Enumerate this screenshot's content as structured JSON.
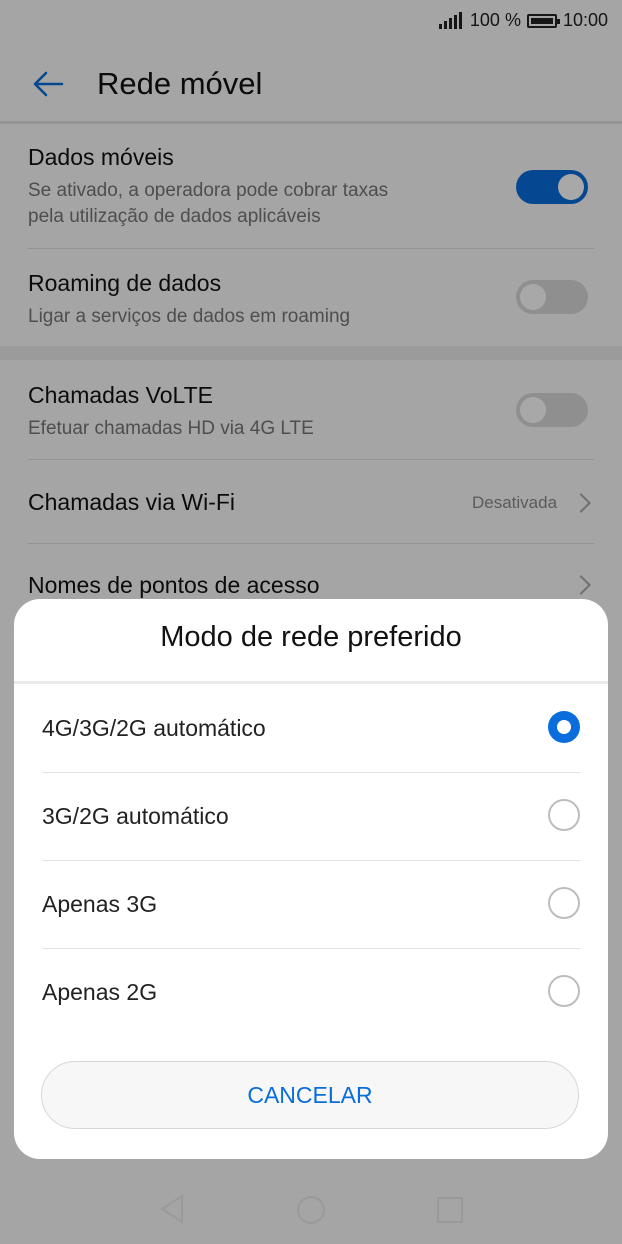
{
  "status_bar": {
    "battery_text": "100 %",
    "time": "10:00"
  },
  "header": {
    "title": "Rede móvel",
    "back_icon": "arrow-left-icon"
  },
  "settings": {
    "mobile_data": {
      "title": "Dados móveis",
      "subtitle_line1": "Se ativado, a operadora pode cobrar taxas",
      "subtitle_line2": "pela utilização de dados aplicáveis",
      "enabled": true
    },
    "data_roaming": {
      "title": "Roaming de dados",
      "subtitle": "Ligar a serviços de dados em roaming",
      "enabled": false
    },
    "volte": {
      "title": "Chamadas VoLTE",
      "subtitle": "Efetuar chamadas HD via 4G LTE",
      "enabled": false
    },
    "wifi_calling": {
      "title": "Chamadas via Wi-Fi",
      "value": "Desativada"
    },
    "apn": {
      "title": "Nomes de pontos de acesso"
    }
  },
  "dialog": {
    "title": "Modo de rede preferido",
    "options": [
      {
        "label": "4G/3G/2G automático",
        "selected": true
      },
      {
        "label": "3G/2G automático",
        "selected": false
      },
      {
        "label": "Apenas 3G",
        "selected": false
      },
      {
        "label": "Apenas 2G",
        "selected": false
      }
    ],
    "cancel_label": "CANCELAR"
  },
  "colors": {
    "accent": "#0a6ddc",
    "toggle_off": "#d9d9d9"
  }
}
